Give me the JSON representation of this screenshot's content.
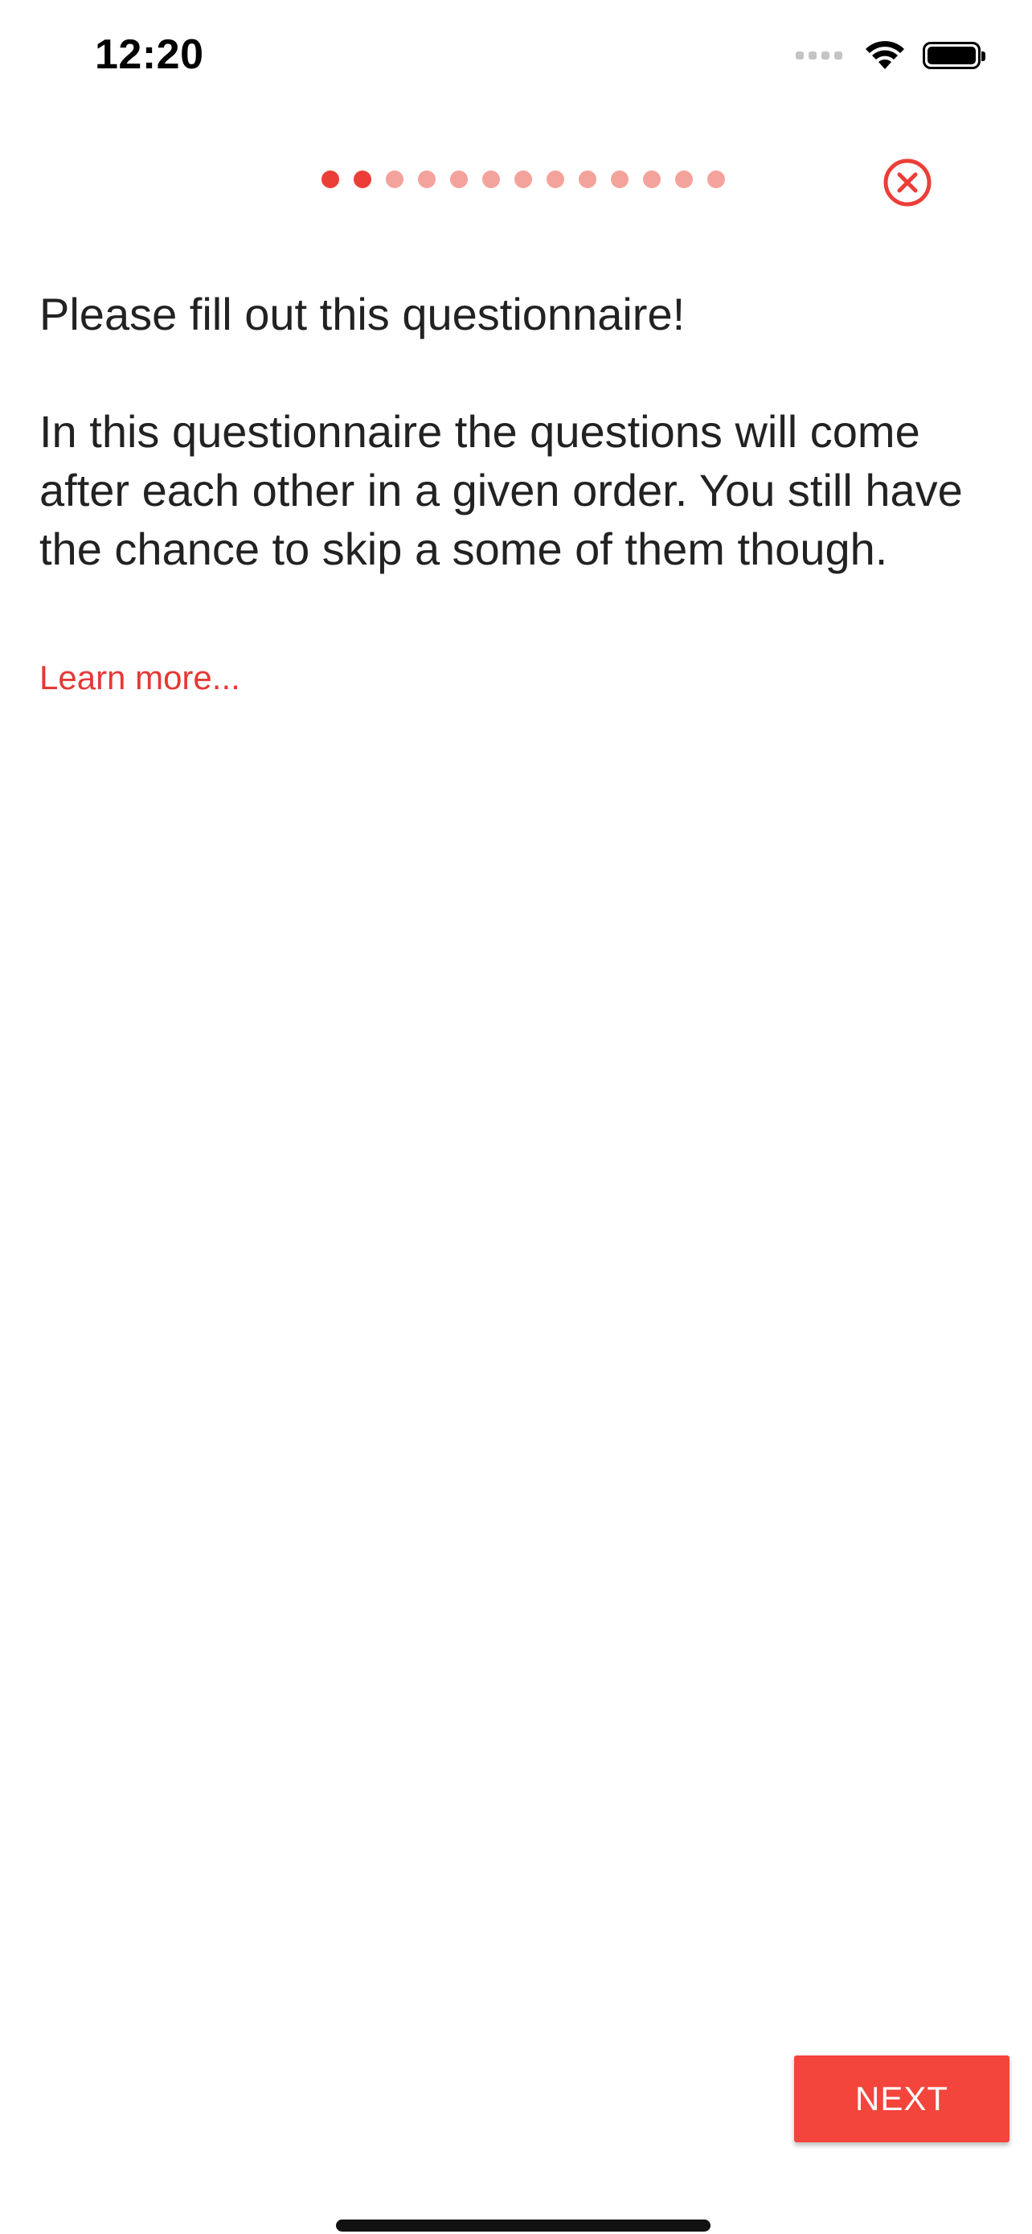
{
  "status_bar": {
    "time": "12:20",
    "icons": [
      "cellular-signal-icon",
      "wifi-icon",
      "battery-icon"
    ]
  },
  "header": {
    "progress": {
      "total_steps": 13,
      "active_steps": 2
    },
    "close_icon": "close-circle-icon"
  },
  "content": {
    "intro_text": "Please fill out this questionnaire!\n\nIn this questionnaire the questions will come after each other in a given order. You still have the chance to skip a some of them though.",
    "learn_more_label": "Learn more..."
  },
  "footer": {
    "next_label": "NEXT"
  },
  "colors": {
    "accent": "#ec3e37",
    "accent_light": "#f4a39c",
    "button": "#f3453b",
    "text": "#222222"
  }
}
